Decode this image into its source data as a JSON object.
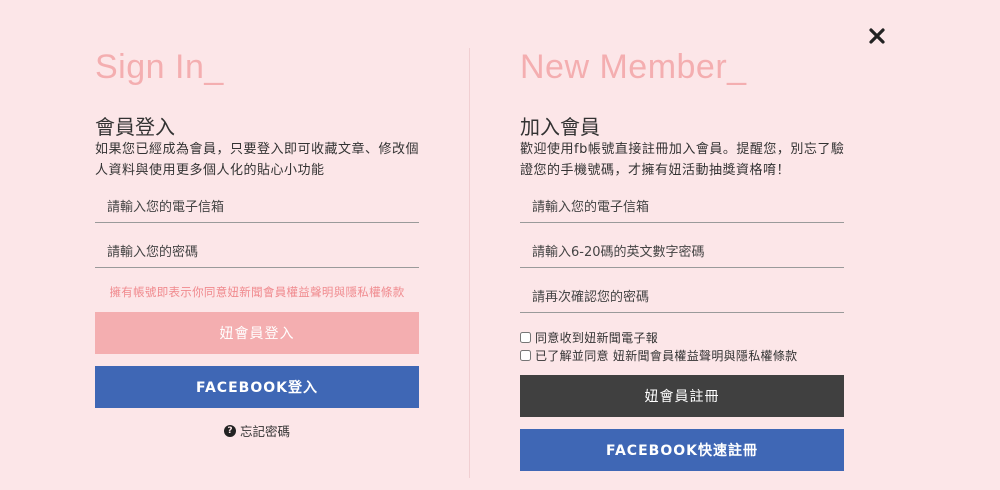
{
  "close": {
    "icon": "close-icon"
  },
  "signin": {
    "title": "Sign In_",
    "subtitle": "會員登入",
    "description": "如果您已經成為會員，只要登入即可收藏文章、修改個人資料與使用更多個人化的貼心小功能",
    "email_placeholder": "請輸入您的電子信箱",
    "password_placeholder": "請輸入您的密碼",
    "agreement": "擁有帳號即表示你同意妞新聞會員權益聲明與隱私權條款",
    "login_button": "妞會員登入",
    "facebook_button": "FACEBOOK登入",
    "forgot_password": "忘記密碼",
    "forgot_icon": "question-circle-icon"
  },
  "signup": {
    "title": "New Member_",
    "subtitle": "加入會員",
    "description": "歡迎使用fb帳號直接註冊加入會員。提醒您，別忘了驗證您的手機號碼，才擁有妞活動抽獎資格唷！",
    "email_placeholder": "請輸入您的電子信箱",
    "password_placeholder": "請輸入6-20碼的英文數字密碼",
    "confirm_placeholder": "請再次確認您的密碼",
    "newsletter_label": "同意收到妞新聞電子報",
    "terms_label": "已了解並同意 妞新聞會員權益聲明與隱私權條款",
    "register_button": "妞會員註冊",
    "facebook_button": "FACEBOOK快速註冊"
  },
  "colors": {
    "background": "#fce6e8",
    "accent_pink": "#f4aeb0",
    "facebook_blue": "#3f67b5",
    "dark_button": "#404040",
    "agreement_text": "#f08a8e"
  }
}
